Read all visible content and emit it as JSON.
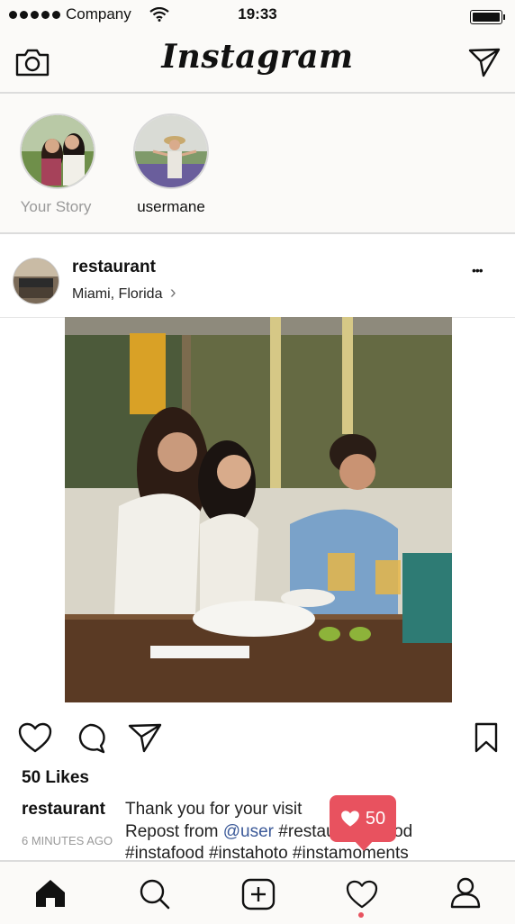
{
  "status_bar": {
    "carrier": "Company",
    "time": "19:33"
  },
  "header": {
    "logo": "Instagram"
  },
  "stories": [
    {
      "label": "Your Story"
    },
    {
      "label": "usermane"
    }
  ],
  "post": {
    "username": "restaurant",
    "location": "Miami, Florida",
    "location_chevron": "›",
    "more": "•••",
    "likes": "50 Likes",
    "caption_user": "restaurant",
    "time_ago": "6 MINUTES AGO",
    "caption_line1": "Thank you for your visit",
    "caption_line2_a": "Repost from ",
    "caption_line2_mention": "@user",
    "caption_line2_b": " #restaurant #food",
    "caption_line3": "#instafood #instahoto #instamoments"
  },
  "notification": {
    "count": "50"
  },
  "colors": {
    "accent": "#e8525f",
    "mention": "#3b5998",
    "bar_bg": "#fbfaf8"
  },
  "icons": [
    "camera-icon",
    "send-icon",
    "more-icon",
    "heart-icon",
    "comment-icon",
    "share-icon",
    "bookmark-icon",
    "home-icon",
    "search-icon",
    "add-icon",
    "activity-icon",
    "profile-icon"
  ]
}
